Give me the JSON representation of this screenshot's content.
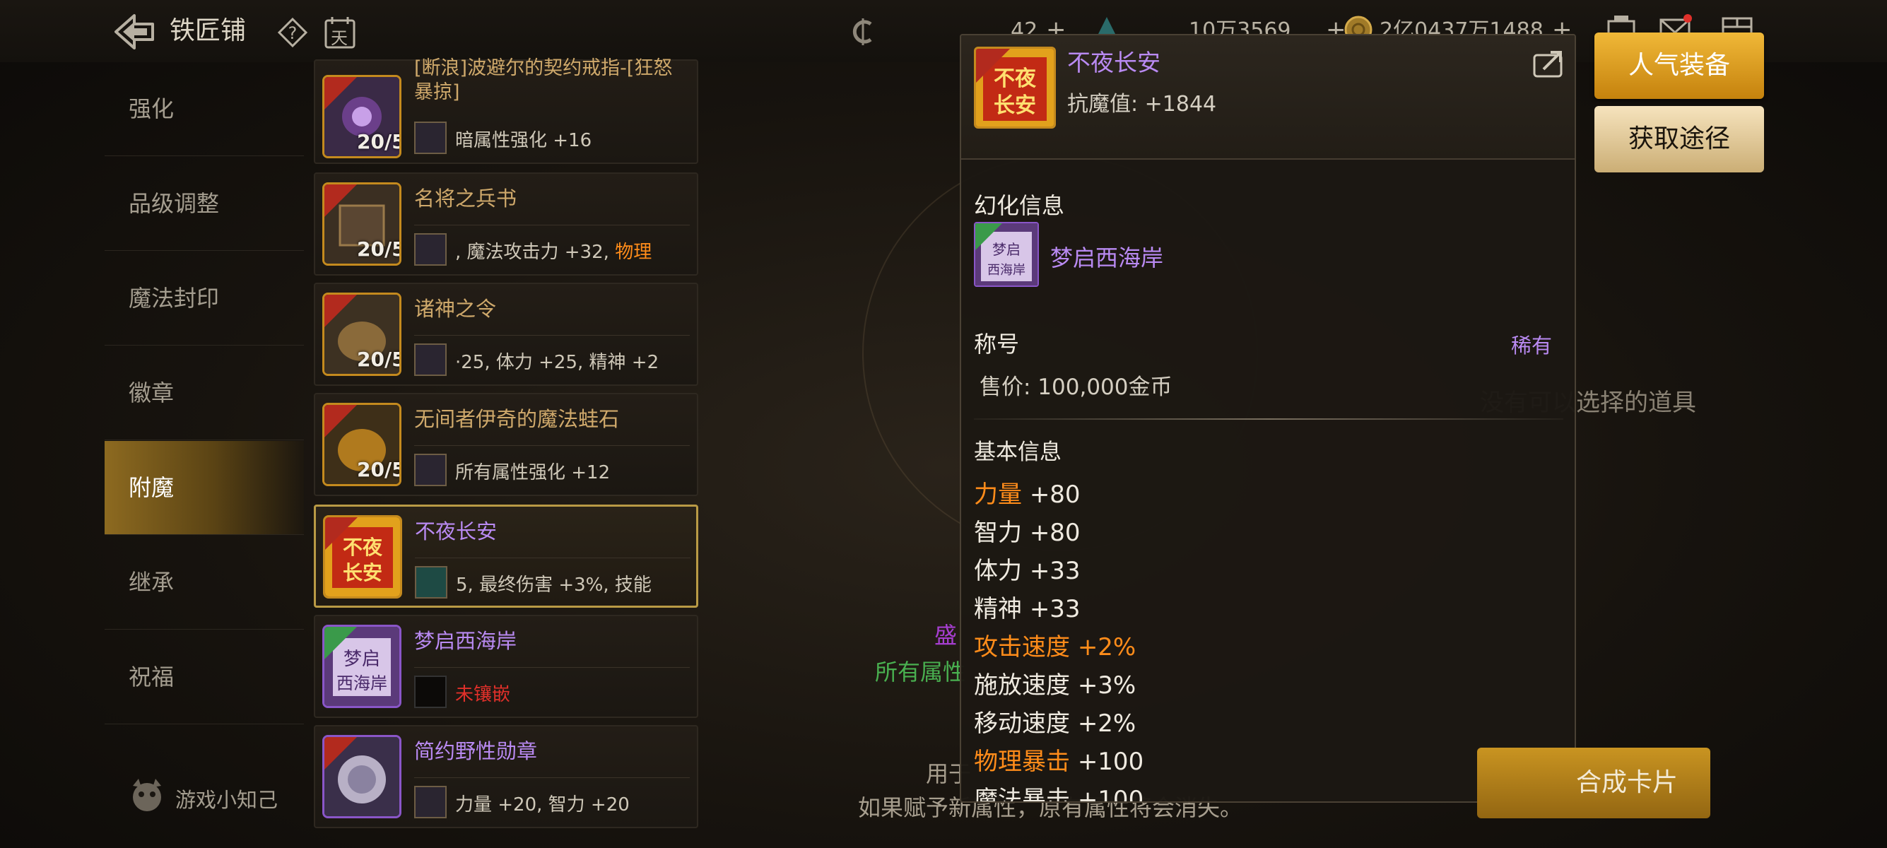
{
  "header": {
    "title": "铁匠铺",
    "help_icon": "question-diamond-icon",
    "calendar_label": "天",
    "currency1": "42",
    "currency2": "10万3569",
    "currency3": "2亿0437万1488",
    "plus": "+"
  },
  "nav": {
    "items": [
      "强化",
      "品级调整",
      "魔法封印",
      "徽章",
      "附魔",
      "继承",
      "祝福"
    ],
    "active_index": 4,
    "tips_label": "游戏小知己"
  },
  "items": [
    {
      "name": "[断浪]波避尔的契约戒指-[狂怒暴掠]",
      "badge": "穿戴中",
      "count": "20/5",
      "desc": "暗属性强化 +16"
    },
    {
      "name": "名将之兵书",
      "badge": "穿戴中",
      "count": "20/5",
      "desc": ", 魔法攻击力 +32, ",
      "desc_hl": "物理"
    },
    {
      "name": "诸神之令",
      "badge": "穿戴中",
      "count": "20/5",
      "desc": "·25, 体力 +25, 精神 +2"
    },
    {
      "name": "无间者伊奇的魔法蛙石",
      "badge": "穿戴中",
      "count": "20/5",
      "desc": "所有属性强化 +12"
    },
    {
      "name": "不夜长安",
      "badge": "穿戴中",
      "count": "",
      "desc": "5, 最终伤害 +3%, 技能"
    },
    {
      "name": "梦启西海岸",
      "badge": "皮肤",
      "count": "",
      "desc": "未镶嵌"
    },
    {
      "name": "简约野性勋章",
      "badge": "穿戴中",
      "count": "",
      "desc": "力量 +20, 智力 +20"
    }
  ],
  "center": {
    "line1": "盛",
    "line2": "所有属性",
    "line3": "用于",
    "line3b": "失。",
    "line4": "如果赋予新属性，原有属性将会消失。",
    "empty_hint": "没有可以选择的道具"
  },
  "tooltip": {
    "name": "不夜长安",
    "resist_label": "抗魔值",
    "resist_value": ": +1844",
    "icon_badge": "穿戴中",
    "icon_text": "不夜长安",
    "transform_title": "幻化信息",
    "transform_name": "梦启西海岸",
    "transform_badge": "皮肤",
    "title_label": "称号",
    "rarity": "稀有",
    "price": "售价: 100,000金币",
    "basic_title": "基本信息",
    "stats": [
      {
        "label": "力量",
        "value": "+80",
        "highlight": true,
        "value_highlight": false
      },
      {
        "label": "智力",
        "value": "+80",
        "highlight": false,
        "value_highlight": false
      },
      {
        "label": "体力",
        "value": "+33",
        "highlight": false,
        "value_highlight": false
      },
      {
        "label": "精神",
        "value": "+33",
        "highlight": false,
        "value_highlight": false
      },
      {
        "label": "攻击速度",
        "value": "+2%",
        "highlight": true,
        "value_highlight": true
      },
      {
        "label": "施放速度",
        "value": "+3%",
        "highlight": false,
        "value_highlight": false
      },
      {
        "label": "移动速度",
        "value": "+2%",
        "highlight": false,
        "value_highlight": false
      },
      {
        "label": "物理暴击",
        "value": "+100",
        "highlight": true,
        "value_highlight": false
      },
      {
        "label": "魔法暴击",
        "value": "+100",
        "highlight": false,
        "value_highlight": false
      }
    ]
  },
  "buttons": {
    "popular": "人气装备",
    "obtain": "获取途径",
    "synth": "合成卡片"
  },
  "colors": {
    "gold": "#c48a1e",
    "purple_text": "#b98af2",
    "orange_stat": "#ff8c1a",
    "nav_active": "#8d6a20"
  }
}
